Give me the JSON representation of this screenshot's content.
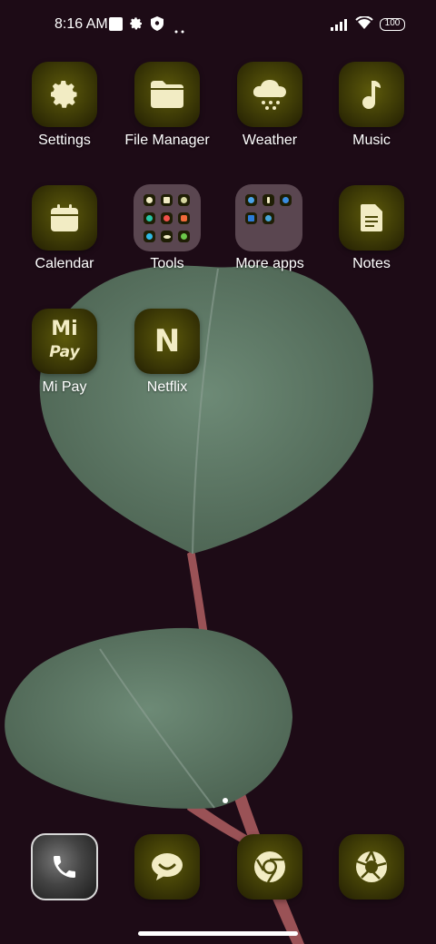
{
  "status_bar": {
    "time": "8:16 AM",
    "battery": "100",
    "icons": [
      "square-icon",
      "gear-icon",
      "shield-icon",
      "more-dots-icon",
      "signal-icon",
      "wifi-icon",
      "battery-icon"
    ]
  },
  "apps": [
    {
      "label": "Settings",
      "icon": "gear-icon"
    },
    {
      "label": "File Manager",
      "icon": "folder-icon"
    },
    {
      "label": "Weather",
      "icon": "weather-cloud-icon"
    },
    {
      "label": "Music",
      "icon": "music-note-icon"
    },
    {
      "label": "Calendar",
      "icon": "calendar-icon"
    },
    {
      "label": "Tools",
      "icon": "folder-grid"
    },
    {
      "label": "More apps",
      "icon": "folder-grid"
    },
    {
      "label": "Notes",
      "icon": "notes-icon"
    },
    {
      "label": "Mi Pay",
      "icon": "mi-pay-icon",
      "logo_text": [
        "Mi",
        "Pay"
      ]
    },
    {
      "label": "Netflix",
      "icon": "netflix-icon",
      "logo_text": "N"
    }
  ],
  "dock": [
    {
      "name": "phone",
      "icon": "phone-icon"
    },
    {
      "name": "messaging",
      "icon": "chat-bubble-icon"
    },
    {
      "name": "browser",
      "icon": "chrome-icon"
    },
    {
      "name": "camera",
      "icon": "camera-shutter-icon"
    }
  ],
  "colors": {
    "wallpaper_bg": "#1d0b16",
    "leaf": "#5f7a67",
    "stem": "#a44a52",
    "icon_tile": "#4d4a09",
    "glyph": "#f2ecc4"
  }
}
